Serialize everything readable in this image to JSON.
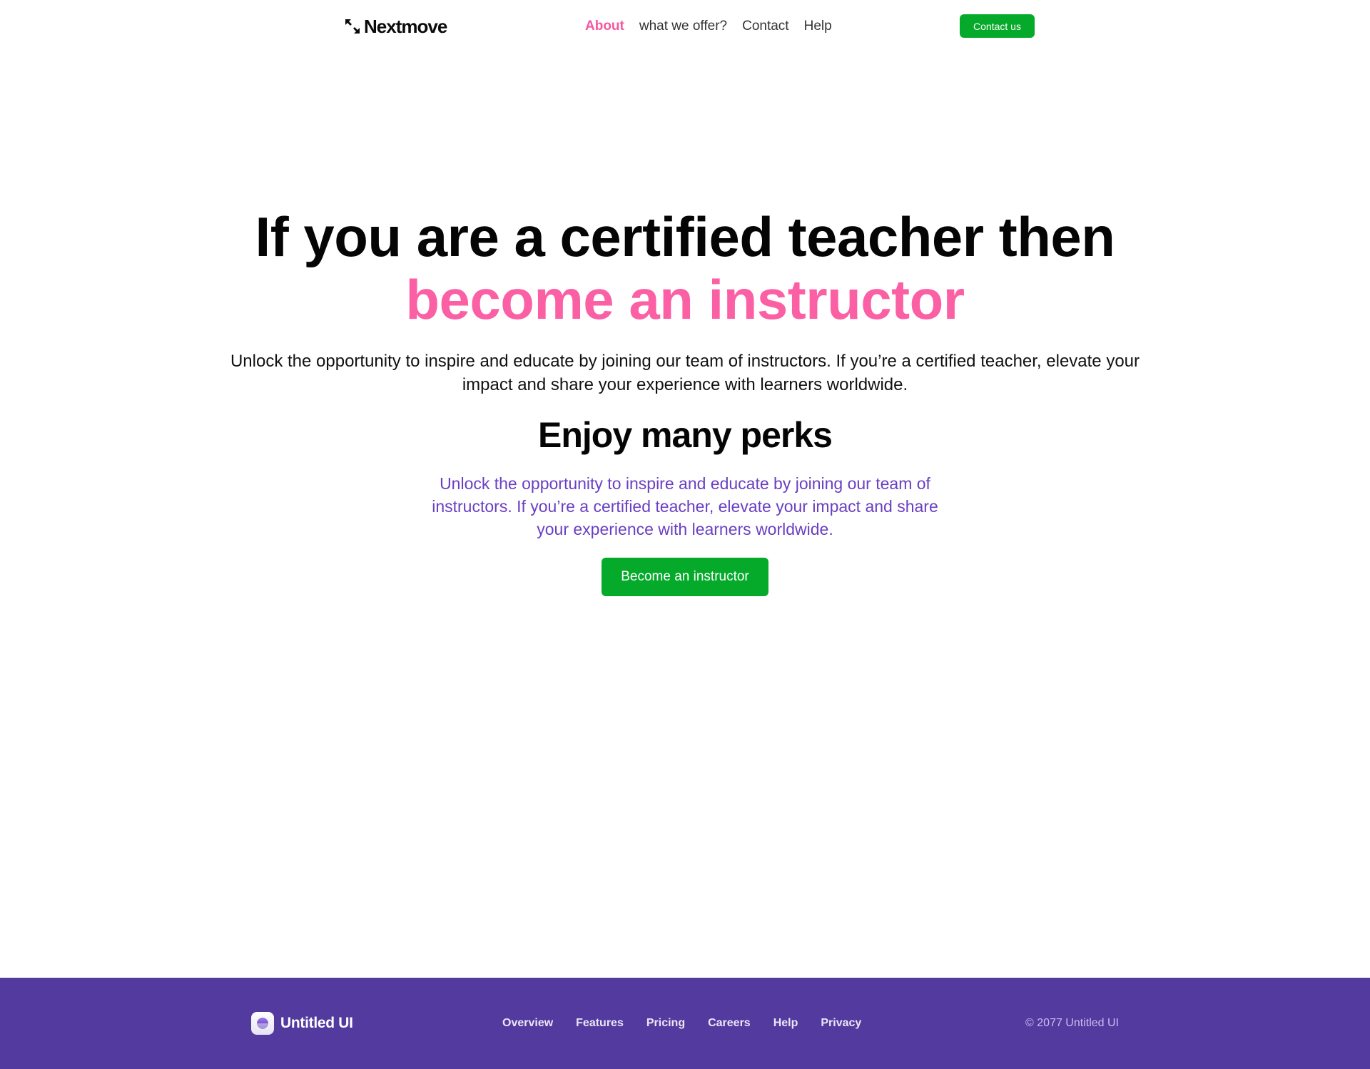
{
  "header": {
    "brand": "Nextmove",
    "nav": [
      {
        "label": "About",
        "active": true
      },
      {
        "label": "what we offer?",
        "active": false
      },
      {
        "label": "Contact",
        "active": false
      },
      {
        "label": "Help",
        "active": false
      }
    ],
    "cta_label": "Contact us"
  },
  "hero": {
    "title_line1": "If you are a certified teacher then",
    "title_line2": "become an instructor",
    "description": "Unlock the opportunity to inspire and educate by joining our team of instructors. If you’re a certified teacher, elevate your impact and share your experience with learners worldwide."
  },
  "perks": {
    "title": "Enjoy many perks",
    "description": "Unlock the opportunity to inspire and educate by joining our team of instructors. If you’re a certified teacher, elevate your impact and share your experience with learners worldwide.",
    "cta_label": "Become an instructor"
  },
  "footer": {
    "brand": "Untitled UI",
    "links": [
      "Overview",
      "Features",
      "Pricing",
      "Careers",
      "Help",
      "Privacy"
    ],
    "copyright": "© 2077 Untitled UI"
  },
  "colors": {
    "accent_pink": "#fb5fa4",
    "nav_active": "#f6589f",
    "cta_green": "#05aa2a",
    "purple_text": "#6a3fc2",
    "footer_bg": "#533a9f"
  },
  "icons": {
    "brand_logo": "arrows-converge-icon",
    "footer_logo": "untitled-ui-logo-icon"
  }
}
